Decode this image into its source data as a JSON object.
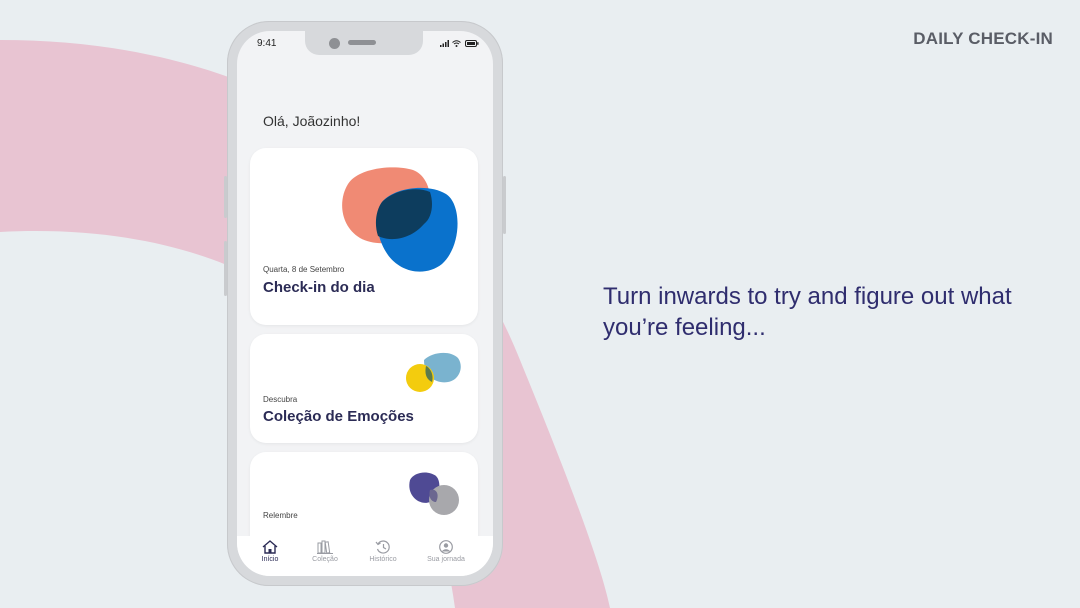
{
  "corner_label": "DAILY CHECK-IN",
  "tagline": "Turn inwards to try and figure out what you’re feeling...",
  "colors": {
    "background": "#e9eef1",
    "arc": "#e8c4d2",
    "text_dark": "#2b2b55",
    "salmon": "#f08a74",
    "blue": "#0a72cc",
    "navy": "#0d3d5e",
    "yellow": "#f3cc0e",
    "lightblue": "#7ab3cf",
    "purple": "#4f4a94",
    "gray": "#a8a8ac"
  },
  "phone": {
    "status_time": "9:41",
    "greeting": "Olá, Joãozinho!",
    "cards": [
      {
        "subtitle": "Quarta, 8 de Setembro",
        "title": "Check-in do dia"
      },
      {
        "subtitle": "Descubra",
        "title": "Coleção de Emoções"
      },
      {
        "subtitle": "Relembre",
        "title": ""
      }
    ],
    "tabs": [
      {
        "label": "Início",
        "icon": "home-icon",
        "active": true
      },
      {
        "label": "Coleção",
        "icon": "books-icon",
        "active": false
      },
      {
        "label": "Histórico",
        "icon": "history-icon",
        "active": false
      },
      {
        "label": "Sua jornada",
        "icon": "user-icon",
        "active": false
      }
    ]
  }
}
